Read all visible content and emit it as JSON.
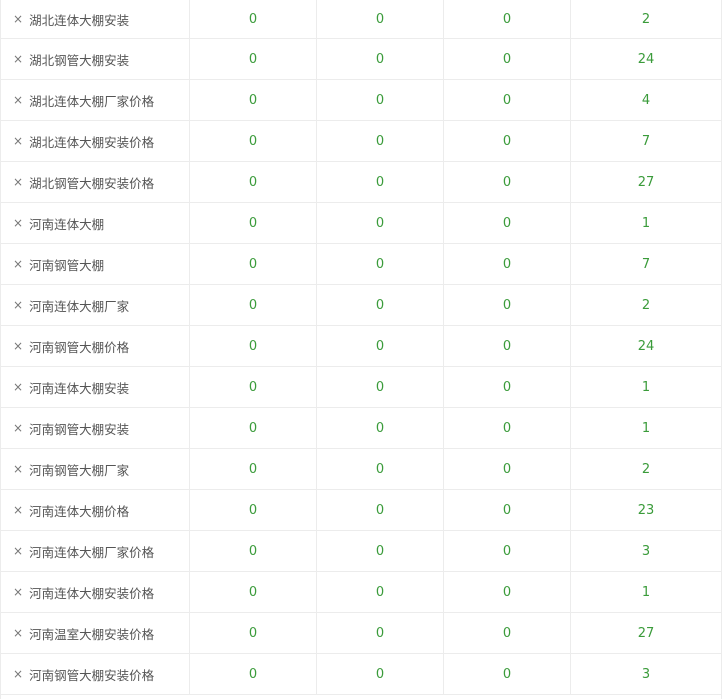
{
  "rows": [
    {
      "keyword": "湖北连体大棚安装",
      "remove_icon": "×",
      "v1": "0",
      "v2": "0",
      "v3": "0",
      "v4": "2"
    },
    {
      "keyword": "湖北钢管大棚安装",
      "remove_icon": "×",
      "v1": "0",
      "v2": "0",
      "v3": "0",
      "v4": "24"
    },
    {
      "keyword": "湖北连体大棚厂家价格",
      "remove_icon": "×",
      "v1": "0",
      "v2": "0",
      "v3": "0",
      "v4": "4"
    },
    {
      "keyword": "湖北连体大棚安装价格",
      "remove_icon": "×",
      "v1": "0",
      "v2": "0",
      "v3": "0",
      "v4": "7"
    },
    {
      "keyword": "湖北钢管大棚安装价格",
      "remove_icon": "×",
      "v1": "0",
      "v2": "0",
      "v3": "0",
      "v4": "27"
    },
    {
      "keyword": "河南连体大棚",
      "remove_icon": "×",
      "v1": "0",
      "v2": "0",
      "v3": "0",
      "v4": "1"
    },
    {
      "keyword": "河南钢管大棚",
      "remove_icon": "×",
      "v1": "0",
      "v2": "0",
      "v3": "0",
      "v4": "7"
    },
    {
      "keyword": "河南连体大棚厂家",
      "remove_icon": "×",
      "v1": "0",
      "v2": "0",
      "v3": "0",
      "v4": "2"
    },
    {
      "keyword": "河南钢管大棚价格",
      "remove_icon": "×",
      "v1": "0",
      "v2": "0",
      "v3": "0",
      "v4": "24"
    },
    {
      "keyword": "河南连体大棚安装",
      "remove_icon": "×",
      "v1": "0",
      "v2": "0",
      "v3": "0",
      "v4": "1"
    },
    {
      "keyword": "河南钢管大棚安装",
      "remove_icon": "×",
      "v1": "0",
      "v2": "0",
      "v3": "0",
      "v4": "1"
    },
    {
      "keyword": "河南钢管大棚厂家",
      "remove_icon": "×",
      "v1": "0",
      "v2": "0",
      "v3": "0",
      "v4": "2"
    },
    {
      "keyword": "河南连体大棚价格",
      "remove_icon": "×",
      "v1": "0",
      "v2": "0",
      "v3": "0",
      "v4": "23"
    },
    {
      "keyword": "河南连体大棚厂家价格",
      "remove_icon": "×",
      "v1": "0",
      "v2": "0",
      "v3": "0",
      "v4": "3"
    },
    {
      "keyword": "河南连体大棚安装价格",
      "remove_icon": "×",
      "v1": "0",
      "v2": "0",
      "v3": "0",
      "v4": "1"
    },
    {
      "keyword": "河南温室大棚安装价格",
      "remove_icon": "×",
      "v1": "0",
      "v2": "0",
      "v3": "0",
      "v4": "27"
    },
    {
      "keyword": "河南钢管大棚安装价格",
      "remove_icon": "×",
      "v1": "0",
      "v2": "0",
      "v3": "0",
      "v4": "3"
    }
  ],
  "colors": {
    "number_green": "#3a9b3a",
    "keyword_gray": "#555555",
    "border": "#ececec"
  }
}
